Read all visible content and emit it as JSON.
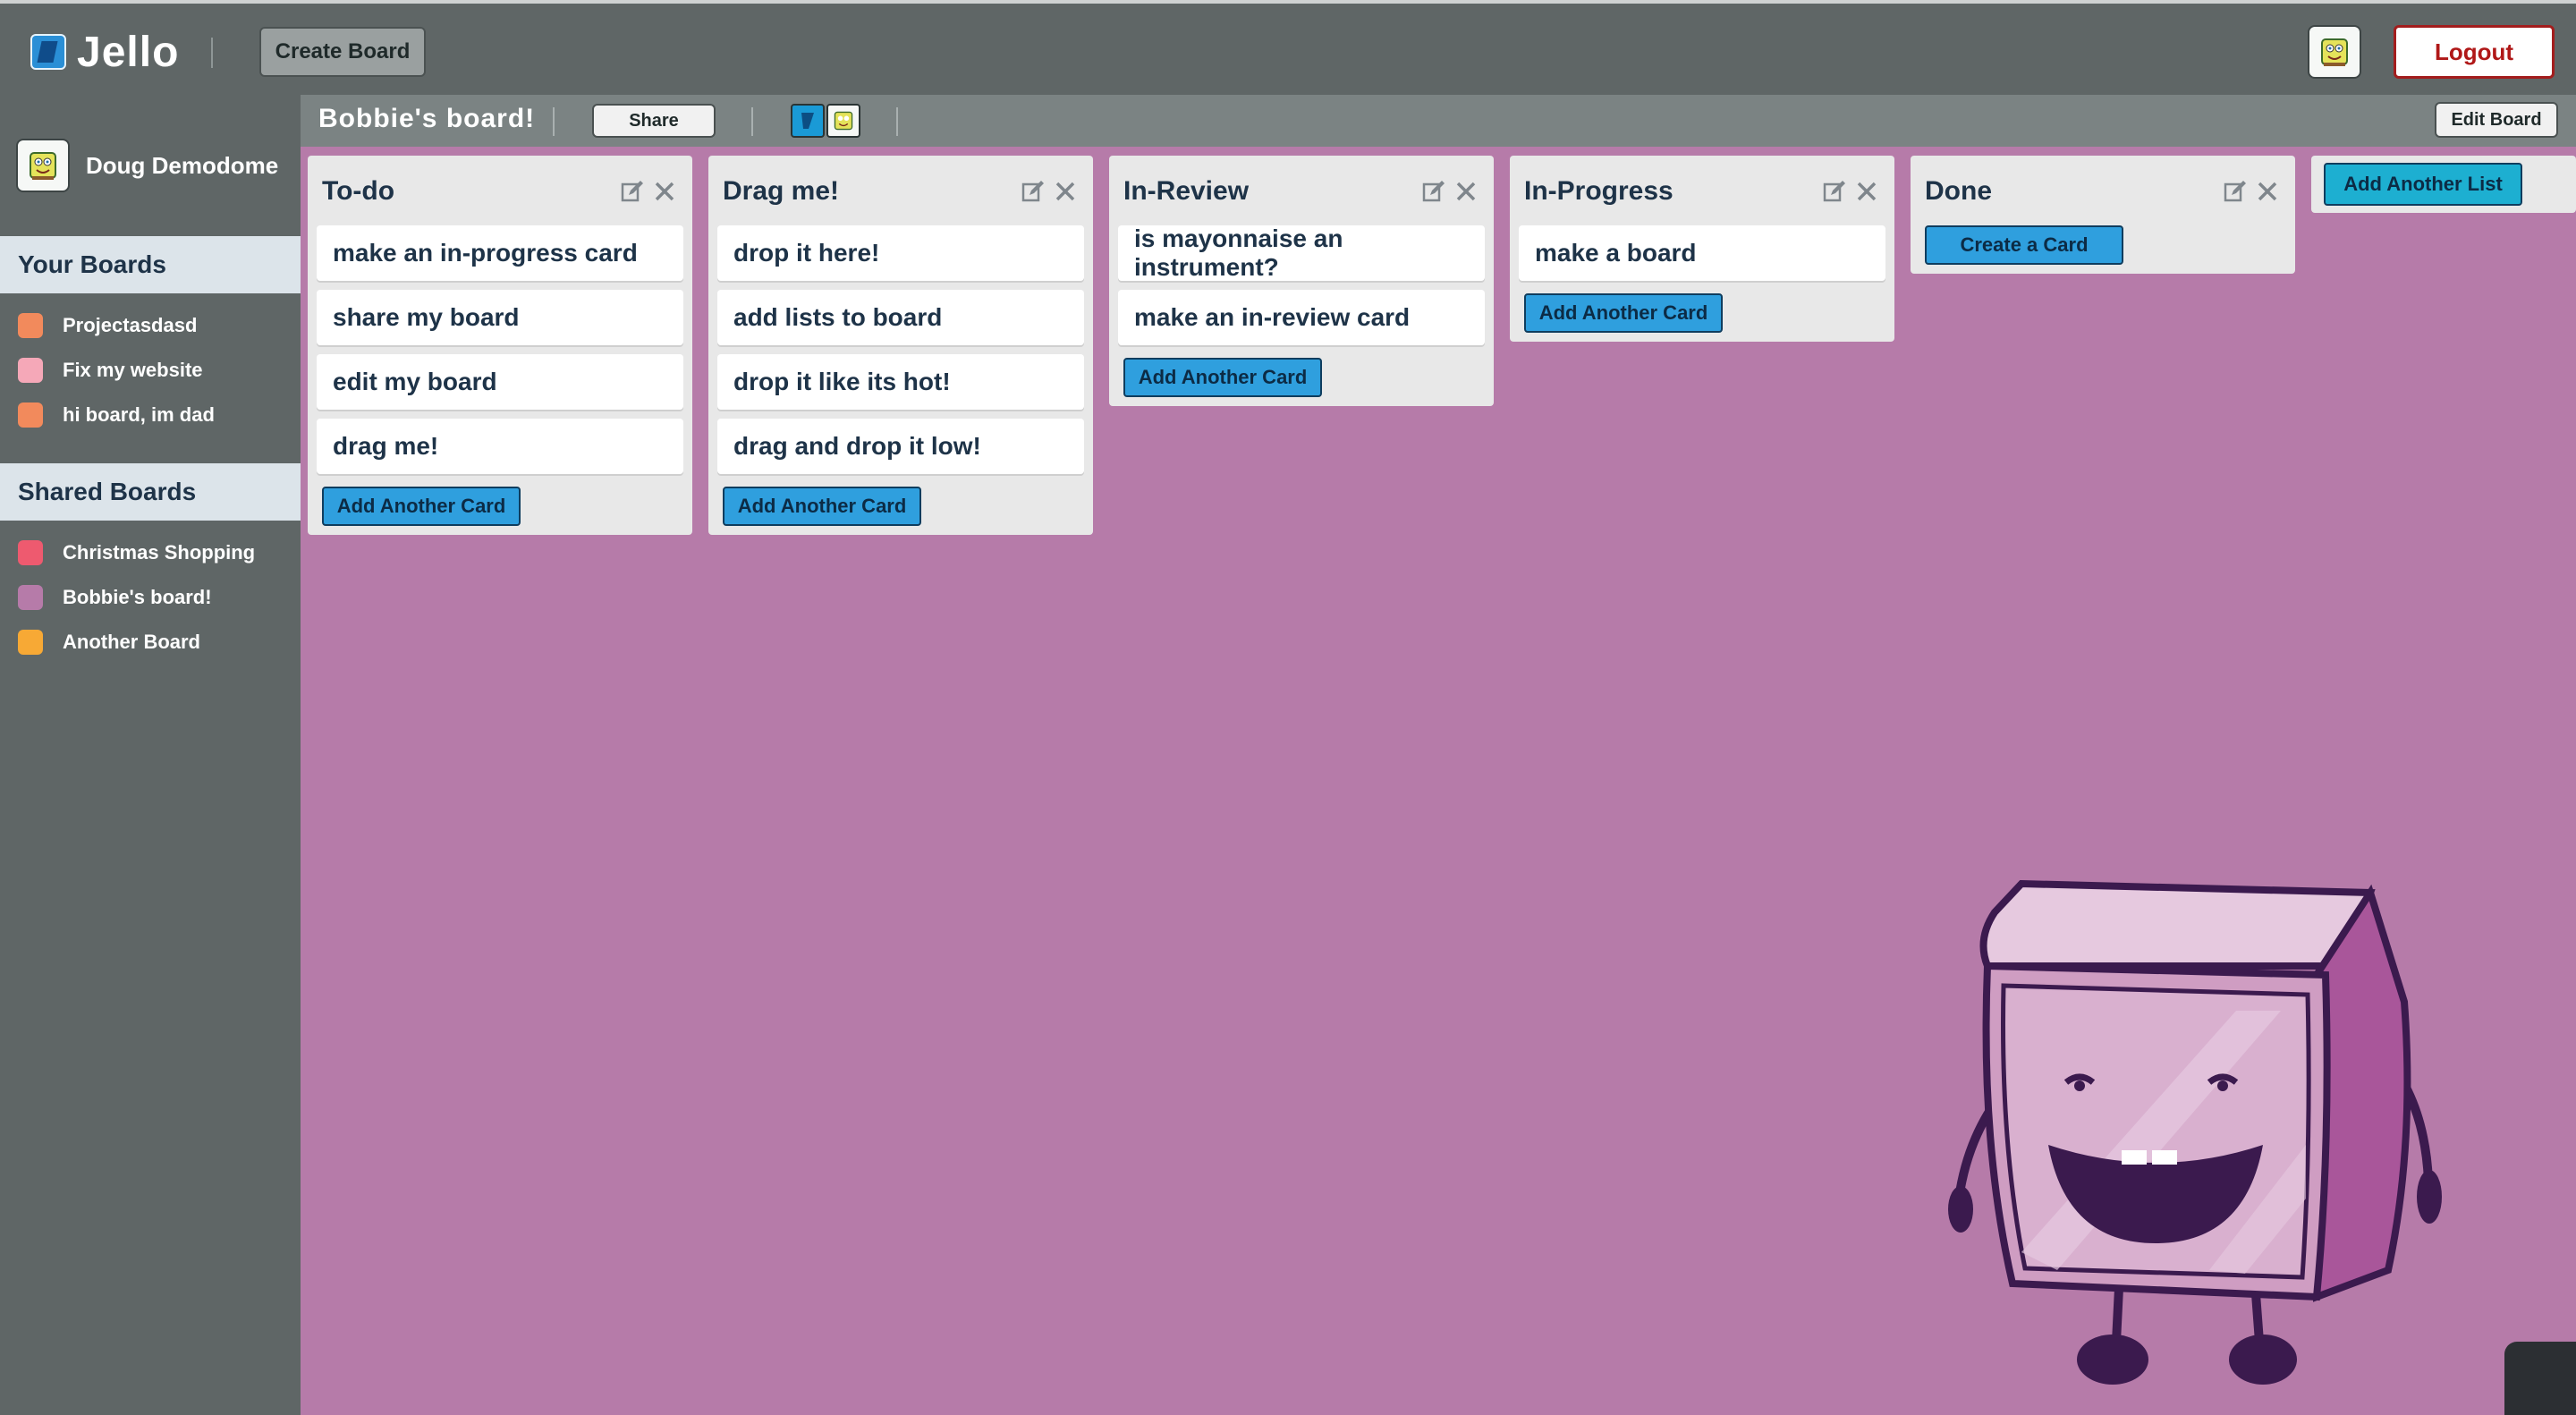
{
  "app": {
    "name": "Jello",
    "create_board": "Create Board",
    "logout": "Logout"
  },
  "user": {
    "name": "Doug Demodome"
  },
  "sidebar": {
    "your_boards_title": "Your Boards",
    "your_boards": [
      {
        "label": "Projectasdasd",
        "color": "#f28a5c"
      },
      {
        "label": "Fix my website",
        "color": "#f5a8b8"
      },
      {
        "label": "hi board, im dad",
        "color": "#f28a5c"
      }
    ],
    "shared_boards_title": "Shared Boards",
    "shared_boards": [
      {
        "label": "Christmas Shopping",
        "color": "#ee5a6f"
      },
      {
        "label": "Bobbie's board!",
        "color": "#b67ba9"
      },
      {
        "label": "Another Board",
        "color": "#f7a935"
      }
    ]
  },
  "board": {
    "title": "Bobbie's board!",
    "share": "Share",
    "edit_board": "Edit Board",
    "add_list": "Add Another List",
    "lists": [
      {
        "title": "To-do",
        "cards": [
          "make an in-progress card",
          "share my board",
          "edit my board",
          "drag me!"
        ],
        "add": "Add Another Card"
      },
      {
        "title": "Drag me!",
        "cards": [
          "drop it here!",
          "add lists to board",
          "drop it like its hot!",
          "drag and drop it low!"
        ],
        "add": "Add Another Card"
      },
      {
        "title": "In-Review",
        "cards": [
          "is mayonnaise an instrument?",
          "make an in-review card"
        ],
        "add": "Add Another Card"
      },
      {
        "title": "In-Progress",
        "cards": [
          "make a board"
        ],
        "add": "Add Another Card"
      },
      {
        "title": "Done",
        "cards": [],
        "add": "Create a Card"
      }
    ]
  }
}
